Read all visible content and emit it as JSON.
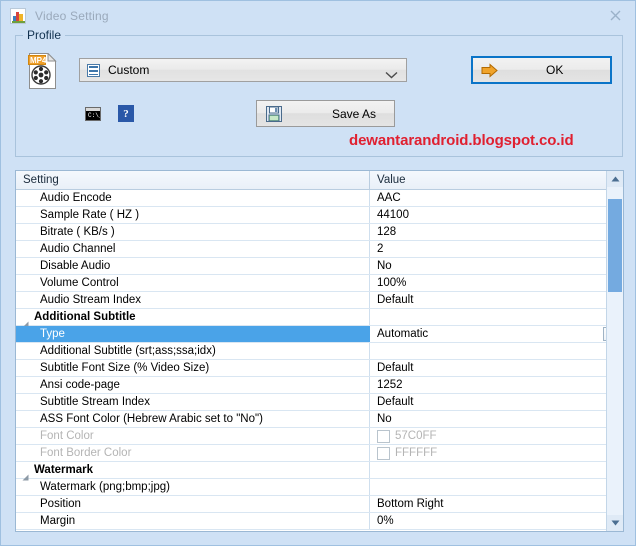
{
  "window": {
    "title": "Video Setting",
    "close_label": "×",
    "title_icon": "picture-icon"
  },
  "profile": {
    "legend": "Profile",
    "file_icon_label": "MP4",
    "combo": {
      "value": "Custom",
      "icon": "film-strip-icon",
      "arrow": "chevron-down-icon"
    },
    "console_button_icon": "command-prompt-icon",
    "help_button_label": "?",
    "save_as": {
      "label": "Save As",
      "icon": "floppy-disk-icon"
    },
    "ok": {
      "label": "OK",
      "icon": "orange-arrow-icon"
    },
    "watermark": "dewantarandroid.blogspot.co.id",
    "watermark_color": "#e02030"
  },
  "grid": {
    "columns": [
      "Setting",
      "Value"
    ],
    "accent_selection_color": "#4aa3e8",
    "rows": [
      {
        "setting": "Audio Encode",
        "value": "AAC",
        "type": "item"
      },
      {
        "setting": "Sample Rate ( HZ )",
        "value": "44100",
        "type": "item"
      },
      {
        "setting": "Bitrate ( KB/s )",
        "value": "128",
        "type": "item"
      },
      {
        "setting": "Audio Channel",
        "value": "2",
        "type": "item"
      },
      {
        "setting": "Disable Audio",
        "value": "No",
        "type": "item"
      },
      {
        "setting": "Volume Control",
        "value": "100%",
        "type": "item"
      },
      {
        "setting": "Audio Stream Index",
        "value": "Default",
        "type": "item"
      },
      {
        "setting": "Additional Subtitle",
        "value": "",
        "type": "group"
      },
      {
        "setting": "Type",
        "value": "Automatic",
        "type": "item",
        "selected": true,
        "dropdown": true
      },
      {
        "setting": "Additional Subtitle (srt;ass;ssa;idx)",
        "value": "",
        "type": "item"
      },
      {
        "setting": "Subtitle Font Size (% Video Size)",
        "value": "Default",
        "type": "item"
      },
      {
        "setting": "Ansi code-page",
        "value": "1252",
        "type": "item"
      },
      {
        "setting": "Subtitle Stream Index",
        "value": "Default",
        "type": "item"
      },
      {
        "setting": "ASS Font Color (Hebrew Arabic set to \"No\")",
        "value": "No",
        "type": "item"
      },
      {
        "setting": "Font Color",
        "value": "57C0FF",
        "type": "item",
        "disabled": true,
        "swatch": true
      },
      {
        "setting": "Font Border Color",
        "value": "FFFFFF",
        "type": "item",
        "disabled": true,
        "swatch": true
      },
      {
        "setting": "Watermark",
        "value": "",
        "type": "group"
      },
      {
        "setting": "Watermark (png;bmp;jpg)",
        "value": "",
        "type": "item"
      },
      {
        "setting": "Position",
        "value": "Bottom Right",
        "type": "item"
      },
      {
        "setting": "Margin",
        "value": "0%",
        "type": "item"
      }
    ],
    "scrollbar": {
      "up_icon": "scroll-up-arrow-icon",
      "down_icon": "scroll-down-arrow-icon"
    }
  }
}
